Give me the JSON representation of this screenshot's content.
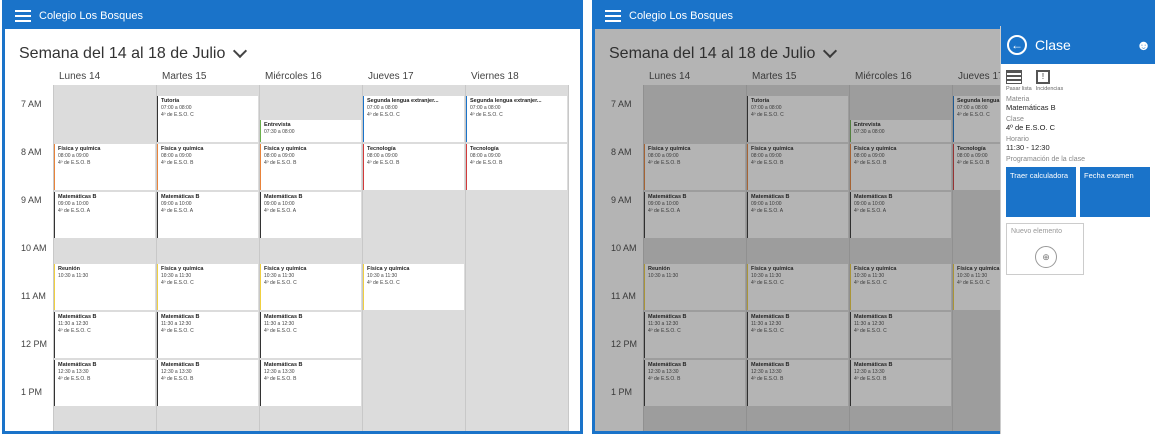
{
  "app_title": "Colegio Los Bosques",
  "week_title": "Semana del 14 al 18 de Julio",
  "days": [
    "Lunes 14",
    "Martes 15",
    "Miércoles 16",
    "Jueves 17",
    "Viernes 18"
  ],
  "hours": [
    "7 AM",
    "8 AM",
    "9 AM",
    "10 AM",
    "11 AM",
    "12 PM",
    "1 PM"
  ],
  "events": [
    {
      "day": 1,
      "title": "Tutoría",
      "time": "07:00 a 08:00",
      "group": "4º de E.S.O. C",
      "color": "#333333",
      "start": 0,
      "end": 1
    },
    {
      "day": 2,
      "title": "Entrevista",
      "time": "07:30 a 08:00",
      "group": "",
      "color": "#6ab04c",
      "start": 0.5,
      "end": 1
    },
    {
      "day": 3,
      "title": "Segunda lengua extranjer...",
      "time": "07:00 a 08:00",
      "group": "4º de E.S.O. C",
      "color": "#1a73c9",
      "start": 0,
      "end": 1
    },
    {
      "day": 4,
      "title": "Segunda lengua extranjer...",
      "time": "07:00 a 08:00",
      "group": "4º de E.S.O. C",
      "color": "#1a73c9",
      "start": 0,
      "end": 1
    },
    {
      "day": 0,
      "title": "Física y química",
      "time": "08:00 a 09:00",
      "group": "4º de E.S.O. B",
      "color": "#e8833a",
      "start": 1,
      "end": 2
    },
    {
      "day": 1,
      "title": "Física y química",
      "time": "08:00 a 09:00",
      "group": "4º de E.S.O. B",
      "color": "#e8833a",
      "start": 1,
      "end": 2
    },
    {
      "day": 2,
      "title": "Física y química",
      "time": "08:00 a 09:00",
      "group": "4º de E.S.O. B",
      "color": "#e8833a",
      "start": 1,
      "end": 2
    },
    {
      "day": 3,
      "title": "Tecnología",
      "time": "08:00 a 09:00",
      "group": "4º de E.S.O. B",
      "color": "#d23a3a",
      "start": 1,
      "end": 2
    },
    {
      "day": 4,
      "title": "Tecnología",
      "time": "08:00 a 09:00",
      "group": "4º de E.S.O. B",
      "color": "#d23a3a",
      "start": 1,
      "end": 2
    },
    {
      "day": 0,
      "title": "Matemáticas B",
      "time": "09:00 a 10:00",
      "group": "4º de E.S.O. A",
      "color": "#333333",
      "start": 2,
      "end": 3
    },
    {
      "day": 1,
      "title": "Matemáticas B",
      "time": "09:00 a 10:00",
      "group": "4º de E.S.O. A",
      "color": "#333333",
      "start": 2,
      "end": 3
    },
    {
      "day": 2,
      "title": "Matemáticas B",
      "time": "09:00 a 10:00",
      "group": "4º de E.S.O. A",
      "color": "#333333",
      "start": 2,
      "end": 3
    },
    {
      "day": 0,
      "title": "Reunión",
      "time": "10:30 a 11:30",
      "group": "",
      "color": "#f0d040",
      "start": 3.5,
      "end": 4.5
    },
    {
      "day": 1,
      "title": "Física y química",
      "time": "10:30 a 11:30",
      "group": "4º de E.S.O. C",
      "color": "#f0d040",
      "start": 3.5,
      "end": 4.5
    },
    {
      "day": 2,
      "title": "Física y química",
      "time": "10:30 a 11:30",
      "group": "4º de E.S.O. C",
      "color": "#f0d040",
      "start": 3.5,
      "end": 4.5
    },
    {
      "day": 3,
      "title": "Física y química",
      "time": "10:30 a 11:30",
      "group": "4º de E.S.O. C",
      "color": "#f0d040",
      "start": 3.5,
      "end": 4.5
    },
    {
      "day": 0,
      "title": "Matemáticas B",
      "time": "11:30 a 12:30",
      "group": "4º de E.S.O. C",
      "color": "#333333",
      "start": 4.5,
      "end": 5.5
    },
    {
      "day": 1,
      "title": "Matemáticas B",
      "time": "11:30 a 12:30",
      "group": "4º de E.S.O. C",
      "color": "#333333",
      "start": 4.5,
      "end": 5.5
    },
    {
      "day": 2,
      "title": "Matemáticas B",
      "time": "11:30 a 12:30",
      "group": "4º de E.S.O. C",
      "color": "#333333",
      "start": 4.5,
      "end": 5.5
    },
    {
      "day": 0,
      "title": "Matemáticas B",
      "time": "12:30 a 13:30",
      "group": "4º de E.S.O. B",
      "color": "#333333",
      "start": 5.5,
      "end": 6.5
    },
    {
      "day": 1,
      "title": "Matemáticas B",
      "time": "12:30 a 13:30",
      "group": "4º de E.S.O. B",
      "color": "#333333",
      "start": 5.5,
      "end": 6.5
    },
    {
      "day": 2,
      "title": "Matemáticas B",
      "time": "12:30 a 13:30",
      "group": "4º de E.S.O. B",
      "color": "#333333",
      "start": 5.5,
      "end": 6.5
    }
  ],
  "panel": {
    "title": "Clase",
    "actions": [
      "Pasar lista",
      "Incidencias"
    ],
    "materia_label": "Materia",
    "materia": "Matemáticas B",
    "clase_label": "Clase",
    "clase": "4º de E.S.O. C",
    "horario_label": "Horario",
    "horario": "11:30 - 12:30",
    "prog_label": "Programación de la clase",
    "tiles": [
      "Traer calculadora",
      "Fecha examen"
    ],
    "new_item": "Nuevo elemento"
  }
}
